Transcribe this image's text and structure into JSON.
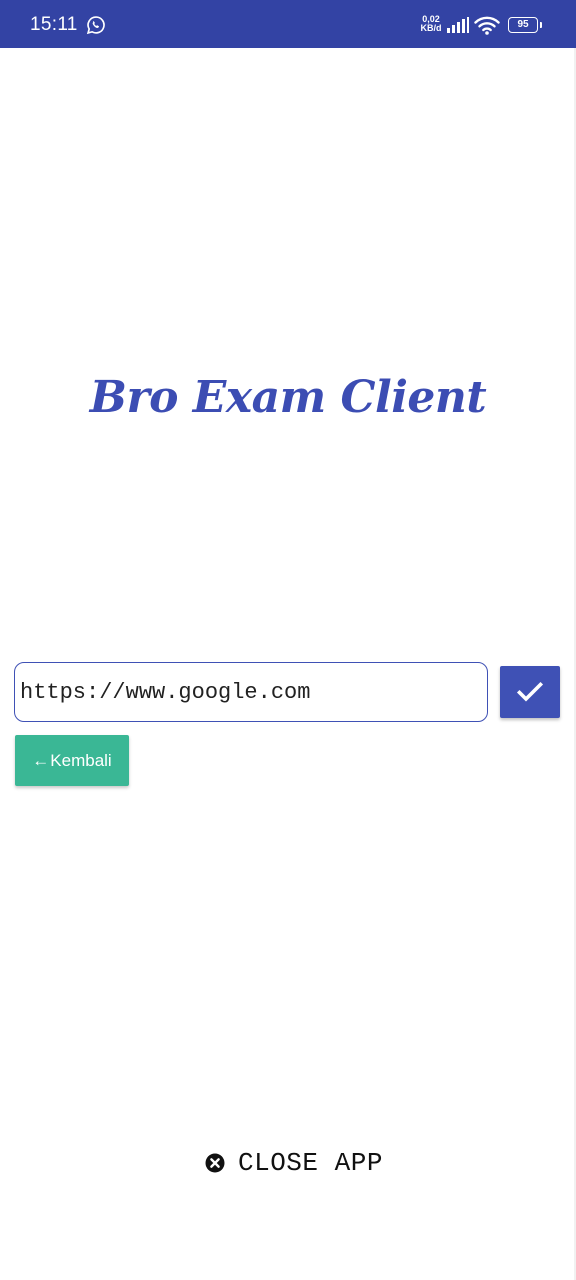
{
  "status_bar": {
    "time": "15:11",
    "net_speed_value": "0,02",
    "net_speed_unit": "KB/d",
    "battery": "95",
    "icons": [
      "whatsapp-icon",
      "signal-icon",
      "wifi-icon",
      "battery-icon"
    ],
    "background_color": "#3343a4"
  },
  "app": {
    "title": "Bro Exam Client",
    "title_color": "#3c4db3"
  },
  "url_form": {
    "value": "https://www.google.com",
    "confirm_icon": "check-icon",
    "accent_color": "#3f51b5"
  },
  "back_button": {
    "arrow": "←",
    "label": "Kembali",
    "color": "#3ab795"
  },
  "close_app": {
    "icon": "close-circle-icon",
    "label": "CLOSE APP"
  }
}
